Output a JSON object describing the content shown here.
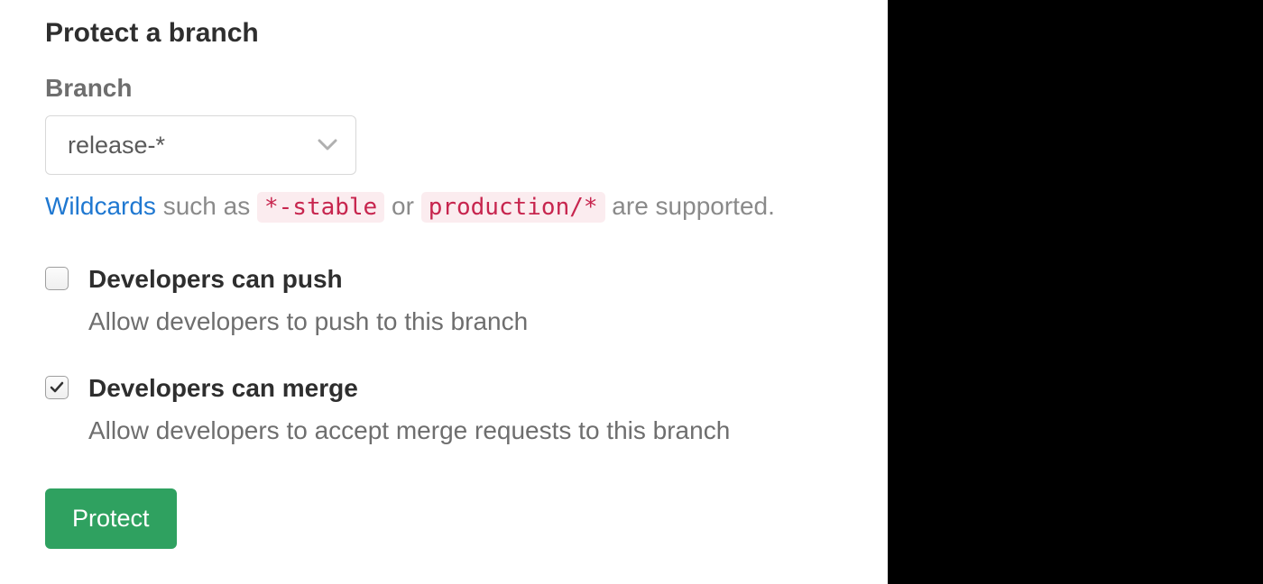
{
  "form": {
    "title": "Protect a branch",
    "branch_label": "Branch",
    "branch_value": "release-*",
    "hint": {
      "link_text": "Wildcards",
      "mid1": " such as ",
      "example1": "*-stable",
      "mid2": " or ",
      "example2": "production/*",
      "tail": " are supported."
    },
    "options": {
      "push": {
        "title": "Developers can push",
        "desc": "Allow developers to push to this branch",
        "checked": false
      },
      "merge": {
        "title": "Developers can merge",
        "desc": "Allow developers to accept merge requests to this branch",
        "checked": true
      }
    },
    "submit_label": "Protect"
  }
}
